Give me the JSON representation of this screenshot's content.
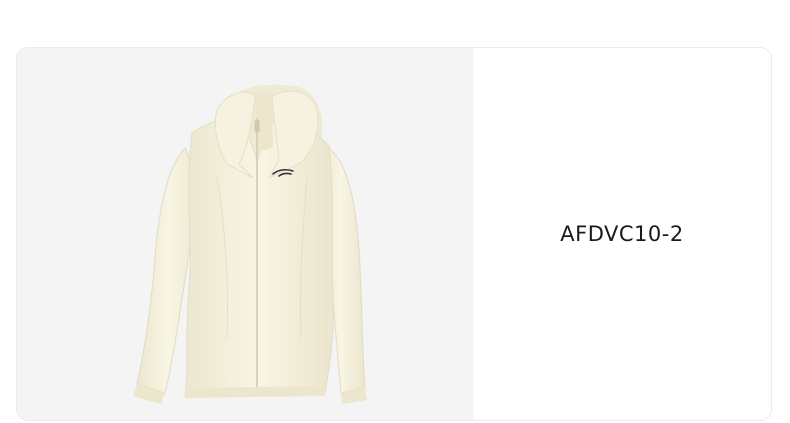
{
  "product": {
    "code": "AFDVC10-2",
    "image_subject": "cream-hooded-zip-jacket",
    "garment_color": "#f7f3e2",
    "image_background": "#f4f4f4"
  }
}
